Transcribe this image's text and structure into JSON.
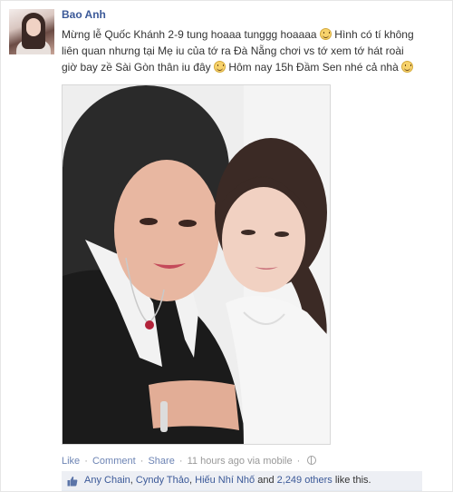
{
  "post": {
    "author": "Bao Anh",
    "message": {
      "line1_text": "Mừng lễ Quốc Khánh 2-9 tung hoaaa tunggg hoaaaa",
      "line1_text_after": " Hình có tí không",
      "line2_text": "liên quan nhưng tại Mẹ iu của tớ ra Đà Nẵng chơi vs tớ xem tớ hát roài",
      "line3_text": "giờ bay zề Sài Gòn thân iu đây",
      "line3_text_after": " Hôm nay 15h Đầm Sen nhé cả nhà"
    },
    "emoji_icon": "smiley-emoticon-icon"
  },
  "actions": {
    "like": "Like",
    "comment": "Comment",
    "share": "Share",
    "dot": "·",
    "time": "11 hours ago via mobile",
    "privacy_icon": "globe-icon"
  },
  "likes": {
    "icon": "thumbs-up-icon",
    "person1": "Any Chain",
    "sep1": ", ",
    "person2": "Cyndy Thảo",
    "sep2": ", ",
    "person3": "Hiếu Nhí Nhố",
    "and": " and ",
    "others": "2,249 others",
    "suffix": " like this."
  },
  "colors": {
    "link": "#3b5998",
    "meta_link": "#6d84b4",
    "like_bar_bg": "#edeff4"
  }
}
